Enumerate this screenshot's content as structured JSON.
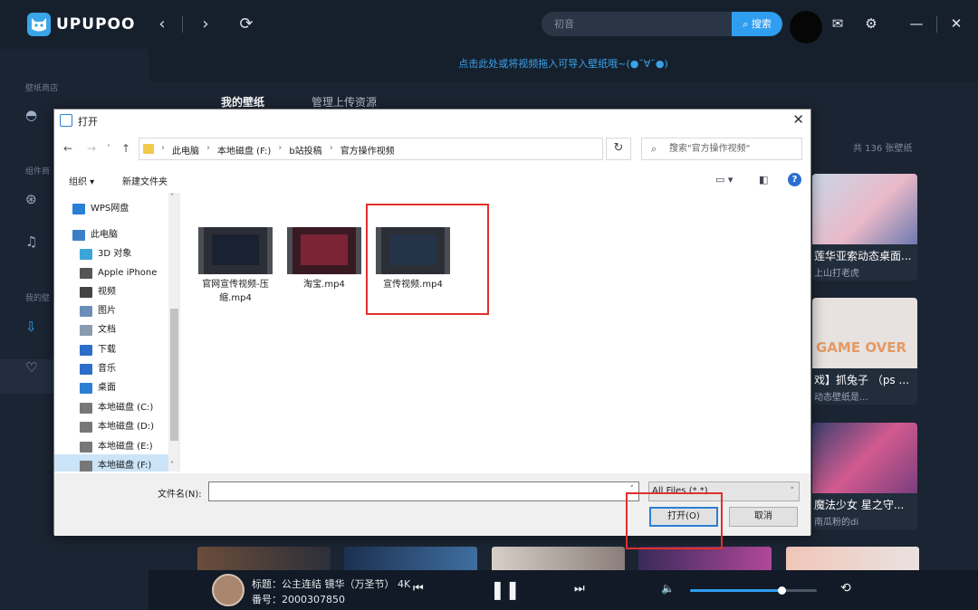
{
  "app": {
    "name": "UPUPOO",
    "search_placeholder": "初音",
    "search_button": "搜索",
    "banner": "点击此处或将视频拖入可导入壁纸哦~(●˘∀˘●)",
    "colors": {
      "accent": "#2f9ef0",
      "bg": "#1b2432"
    }
  },
  "sidebar": {
    "sections": [
      {
        "heading": "壁纸商店"
      },
      {
        "heading": "组件商"
      },
      {
        "heading": "我的壁"
      }
    ],
    "icons": [
      "planet-icon",
      "gamepad-icon",
      "music-icon",
      "download-icon",
      "heart-icon"
    ]
  },
  "main": {
    "tabs": [
      {
        "label": "我的壁纸",
        "active": true
      },
      {
        "label": "管理上传资源",
        "active": false
      }
    ],
    "count_text": "共 136 张壁纸",
    "cards": [
      {
        "title": "莲华亚索动态桌面...",
        "author": "上山打老虎"
      },
      {
        "title": "戏】抓兔子 （ps ...",
        "author": "动态壁纸是..."
      },
      {
        "title": "魔法少女 星之守...",
        "author": "南瓜粉的di"
      }
    ],
    "card_art_text": "GAME OVER"
  },
  "player": {
    "title": "标题：公主连结 镜华（万圣节） 4K",
    "number": "番号：2000307850",
    "volume": 0.72
  },
  "dialog": {
    "title": "打开",
    "breadcrumbs": [
      "此电脑",
      "本地磁盘 (F:)",
      "b站投稿",
      "官方操作视频"
    ],
    "search_placeholder": "搜索\"官方操作视频\"",
    "organize": "组织 ▾",
    "new_folder": "新建文件夹",
    "nav_items": [
      {
        "label": "WPS网盘",
        "icon": "cloud-icon",
        "color": "#2a7fd4"
      },
      {
        "label": "此电脑",
        "icon": "computer-icon",
        "color": "#3d7ec9"
      },
      {
        "label": "3D 对象",
        "icon": "cube-icon",
        "color": "#3aa6d8"
      },
      {
        "label": "Apple iPhone",
        "icon": "phone-icon",
        "color": "#555555"
      },
      {
        "label": "视频",
        "icon": "video-icon",
        "color": "#444444"
      },
      {
        "label": "图片",
        "icon": "image-icon",
        "color": "#6b8fb8"
      },
      {
        "label": "文档",
        "icon": "document-icon",
        "color": "#8a9bb0"
      },
      {
        "label": "下载",
        "icon": "download-icon",
        "color": "#2d6ec9"
      },
      {
        "label": "音乐",
        "icon": "music-icon",
        "color": "#2d6ec9"
      },
      {
        "label": "桌面",
        "icon": "desktop-icon",
        "color": "#2a7fd4"
      },
      {
        "label": "本地磁盘 (C:)",
        "icon": "drive-icon",
        "color": "#777777"
      },
      {
        "label": "本地磁盘 (D:)",
        "icon": "drive-icon",
        "color": "#777777"
      },
      {
        "label": "本地磁盘 (E:)",
        "icon": "drive-icon",
        "color": "#777777"
      },
      {
        "label": "本地磁盘 (F:)",
        "icon": "drive-icon",
        "color": "#777777"
      }
    ],
    "files": [
      {
        "name": "官网宣传视频-压缩.mp4"
      },
      {
        "name": "淘宝.mp4"
      },
      {
        "name": "宣传视频.mp4"
      }
    ],
    "filename_label": "文件名(N):",
    "filename_value": "",
    "filter": "All Files (*.*)",
    "open_button": "打开(O)",
    "cancel_button": "取消",
    "highlight_color": "#e0302c"
  }
}
